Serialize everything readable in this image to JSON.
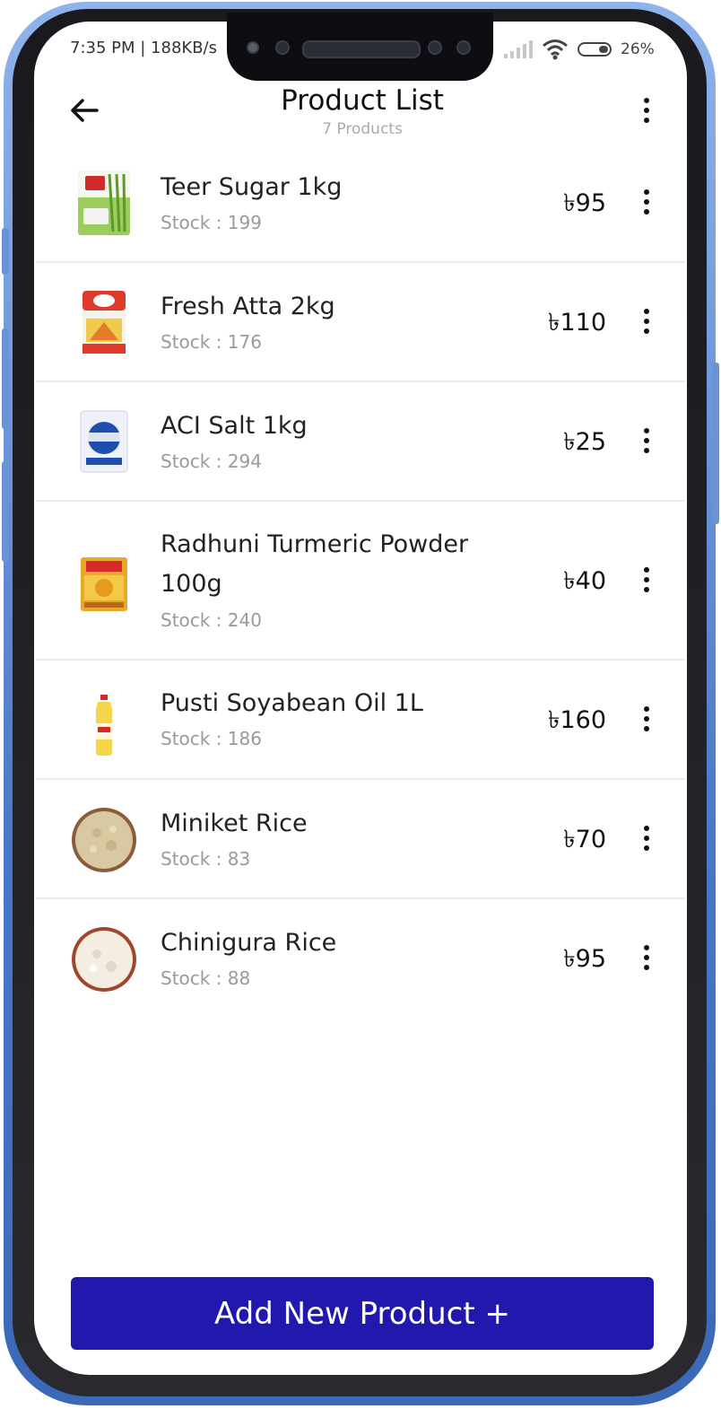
{
  "status_bar": {
    "left_text": "7:35 PM | 188KB/s",
    "battery": "26%"
  },
  "header": {
    "title": "Product List",
    "subtitle": "7 Products"
  },
  "products": [
    {
      "name": "Teer Sugar 1kg",
      "stock": "Stock : 199",
      "price": "৳95"
    },
    {
      "name": "Fresh Atta 2kg",
      "stock": "Stock : 176",
      "price": "৳110"
    },
    {
      "name": "ACI Salt 1kg",
      "stock": "Stock : 294",
      "price": "৳25"
    },
    {
      "name": "Radhuni Turmeric Powder 100g",
      "stock": "Stock : 240",
      "price": "৳40"
    },
    {
      "name": "Pusti Soyabean Oil 1L",
      "stock": "Stock : 186",
      "price": "৳160"
    },
    {
      "name": "Miniket Rice",
      "stock": "Stock : 83",
      "price": "৳70"
    },
    {
      "name": "Chinigura Rice",
      "stock": "Stock : 88",
      "price": "৳95"
    }
  ],
  "add_button": {
    "label": "Add New Product +"
  },
  "colors": {
    "primary": "#2318ad",
    "frame": "#4a78c8"
  }
}
